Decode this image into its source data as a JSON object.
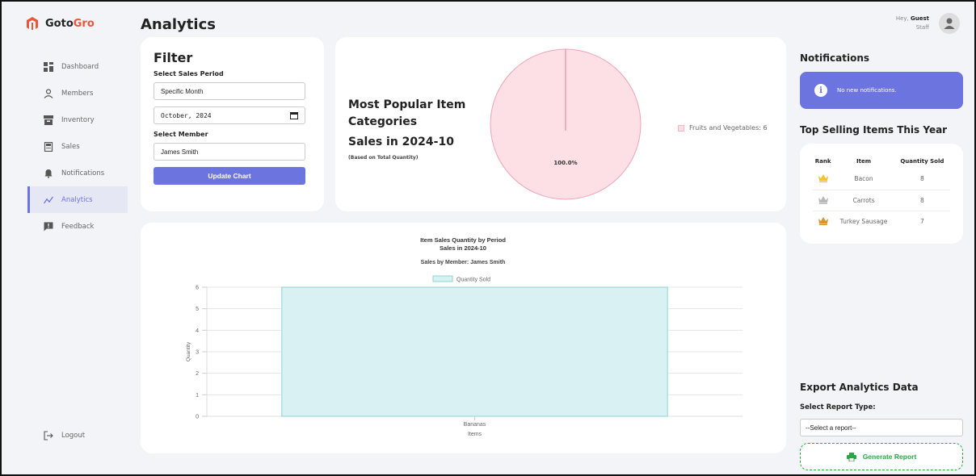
{
  "app": {
    "name_part1": "Goto",
    "name_part2": "Gro"
  },
  "page": {
    "title": "Analytics"
  },
  "user": {
    "greeting": "Hey, ",
    "name": "Guest",
    "role": "Staff"
  },
  "nav": {
    "items": [
      {
        "label": "Dashboard",
        "icon": "dashboard-icon"
      },
      {
        "label": "Members",
        "icon": "members-icon"
      },
      {
        "label": "Inventory",
        "icon": "inventory-icon"
      },
      {
        "label": "Sales",
        "icon": "sales-icon"
      },
      {
        "label": "Notifications",
        "icon": "bell-icon"
      },
      {
        "label": "Analytics",
        "icon": "analytics-icon",
        "active": true
      },
      {
        "label": "Feedback",
        "icon": "feedback-icon"
      }
    ],
    "logout": "Logout"
  },
  "filter": {
    "title": "Filter",
    "period_label": "Select Sales Period",
    "period_value": "Specific Month",
    "month_value": "October, 2024",
    "member_label": "Select Member",
    "member_value": "James Smith",
    "update_button": "Update Chart"
  },
  "pie": {
    "title": "Most Popular Item Categories",
    "subtitle": "Sales in 2024-10",
    "note": "(Based on Total Quantity)",
    "legend": "Fruits and Vegetables: 6"
  },
  "notifications": {
    "title": "Notifications",
    "message": "No new notifications."
  },
  "top_selling": {
    "title": "Top Selling Items This Year",
    "headers": [
      "Rank",
      "Item",
      "Quantity Sold"
    ],
    "rows": [
      {
        "item": "Bacon",
        "qty": "8",
        "crown": "gold"
      },
      {
        "item": "Carrots",
        "qty": "8",
        "crown": "silver"
      },
      {
        "item": "Turkey Sausage",
        "qty": "7",
        "crown": "bronze"
      }
    ]
  },
  "export": {
    "title": "Export Analytics Data",
    "label": "Select Report Type:",
    "select_value": "--Select a report--",
    "button": "Generate Report"
  },
  "colors": {
    "accent": "#6c74e0",
    "green": "#28a745",
    "pie_fill": "#fde0e6",
    "bar_fill": "#d9f1f2"
  },
  "chart_data": [
    {
      "type": "pie",
      "categories": [
        "Fruits and Vegetables"
      ],
      "values": [
        6
      ],
      "data_labels": [
        "100.0%"
      ],
      "legend_position": "right"
    },
    {
      "type": "bar",
      "title": "Item Sales Quantity by Period",
      "subtitle": "Sales in 2024-10",
      "subtitle2": "Sales by Member: James Smith",
      "categories": [
        "Bananas"
      ],
      "series": [
        {
          "name": "Quantity Sold",
          "values": [
            6
          ]
        }
      ],
      "xlabel": "Items",
      "ylabel": "Quantity",
      "ylim": [
        0,
        6
      ],
      "yticks": [
        "0",
        "1",
        "2",
        "3",
        "4",
        "5",
        "6"
      ],
      "grid": true,
      "legend_position": "top"
    }
  ]
}
